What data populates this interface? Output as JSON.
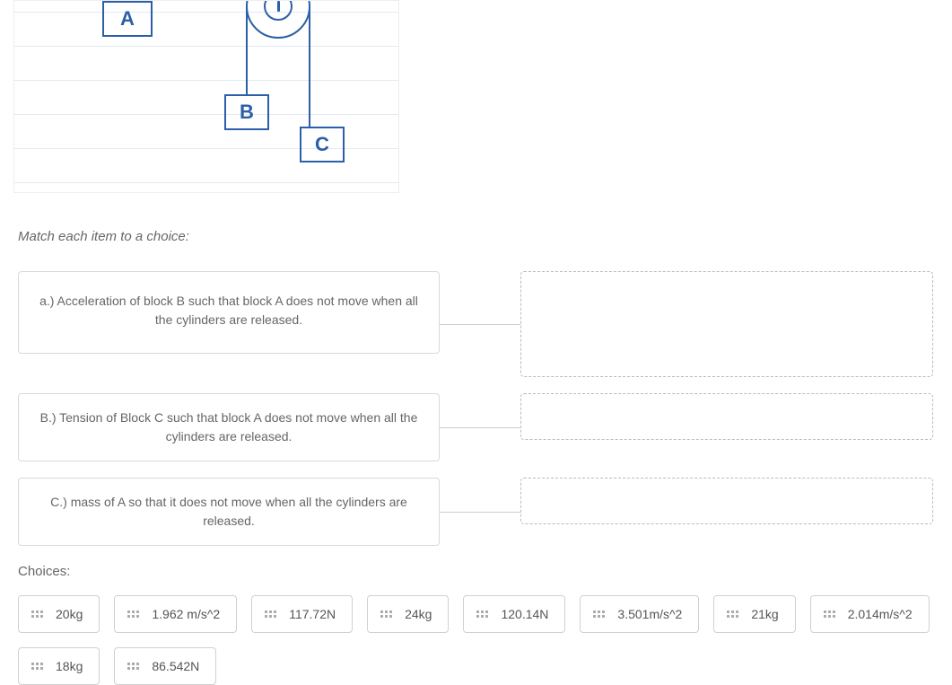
{
  "diagram": {
    "block_a": "A",
    "block_b": "B",
    "block_c": "C"
  },
  "instruction": "Match each item to a choice:",
  "prompts": [
    "a.) Acceleration of block B such that block A does not move when all the cylinders are released.",
    "B.) Tension of Block C such that block A does not move when all the cylinders are released.",
    "C.) mass of A so that it does not move when all the cylinders are released."
  ],
  "choices_label": "Choices:",
  "choices": [
    "20kg",
    "1.962 m/s^2",
    "117.72N",
    "24kg",
    "120.14N",
    "3.501m/s^2",
    "21kg",
    "2.014m/s^2",
    "18kg",
    "86.542N"
  ]
}
